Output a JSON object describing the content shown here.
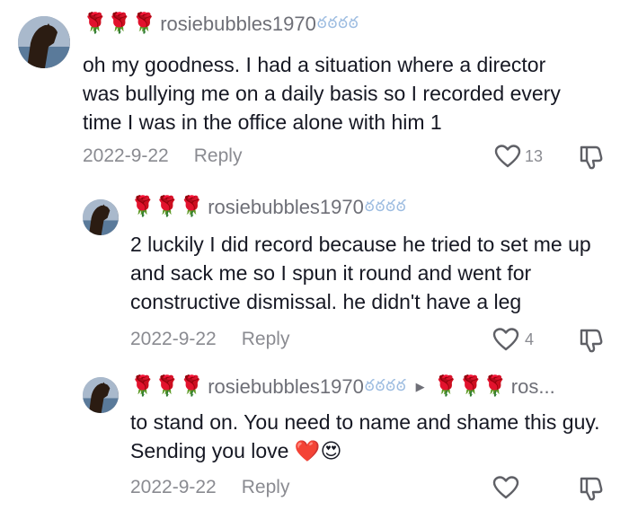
{
  "comments": [
    {
      "username": "rosiebubbles1970",
      "roses": "🌹🌹🌹",
      "bubbles": "ఠఠఠఠ",
      "text": "oh my goodness. I had a situation where a director was bullying me on a daily basis so I recorded every time I was in the office alone with him 1",
      "date": "2022-9-22",
      "reply_label": "Reply",
      "likes": "13"
    },
    {
      "username": "rosiebubbles1970",
      "roses": "🌹🌹🌹",
      "bubbles": "ఠఠఠఠ",
      "text": "2 luckily I did record because he tried to set me up and sack me so I spun it round and went for constructive dismissal. he didn't have a leg",
      "date": "2022-9-22",
      "reply_label": "Reply",
      "likes": "4"
    },
    {
      "username": "rosiebubbles1970",
      "roses": "🌹🌹🌹",
      "bubbles": "ఠఠఠఠ",
      "reply_to_roses": "🌹🌹🌹",
      "reply_to": "ros...",
      "text": "to stand on. You need to name and shame this guy. Sending you love",
      "emojis": "❤️😍",
      "date": "2022-9-22",
      "reply_label": "Reply",
      "likes": ""
    }
  ],
  "icons": {
    "like": "heart-outline-icon",
    "dislike": "thumbs-down-icon",
    "reply_arrow": "triangle-right-icon"
  },
  "colors": {
    "text": "#161823",
    "muted": "#8a8b91",
    "username": "#6e6f77",
    "rose": "#c8102e"
  }
}
